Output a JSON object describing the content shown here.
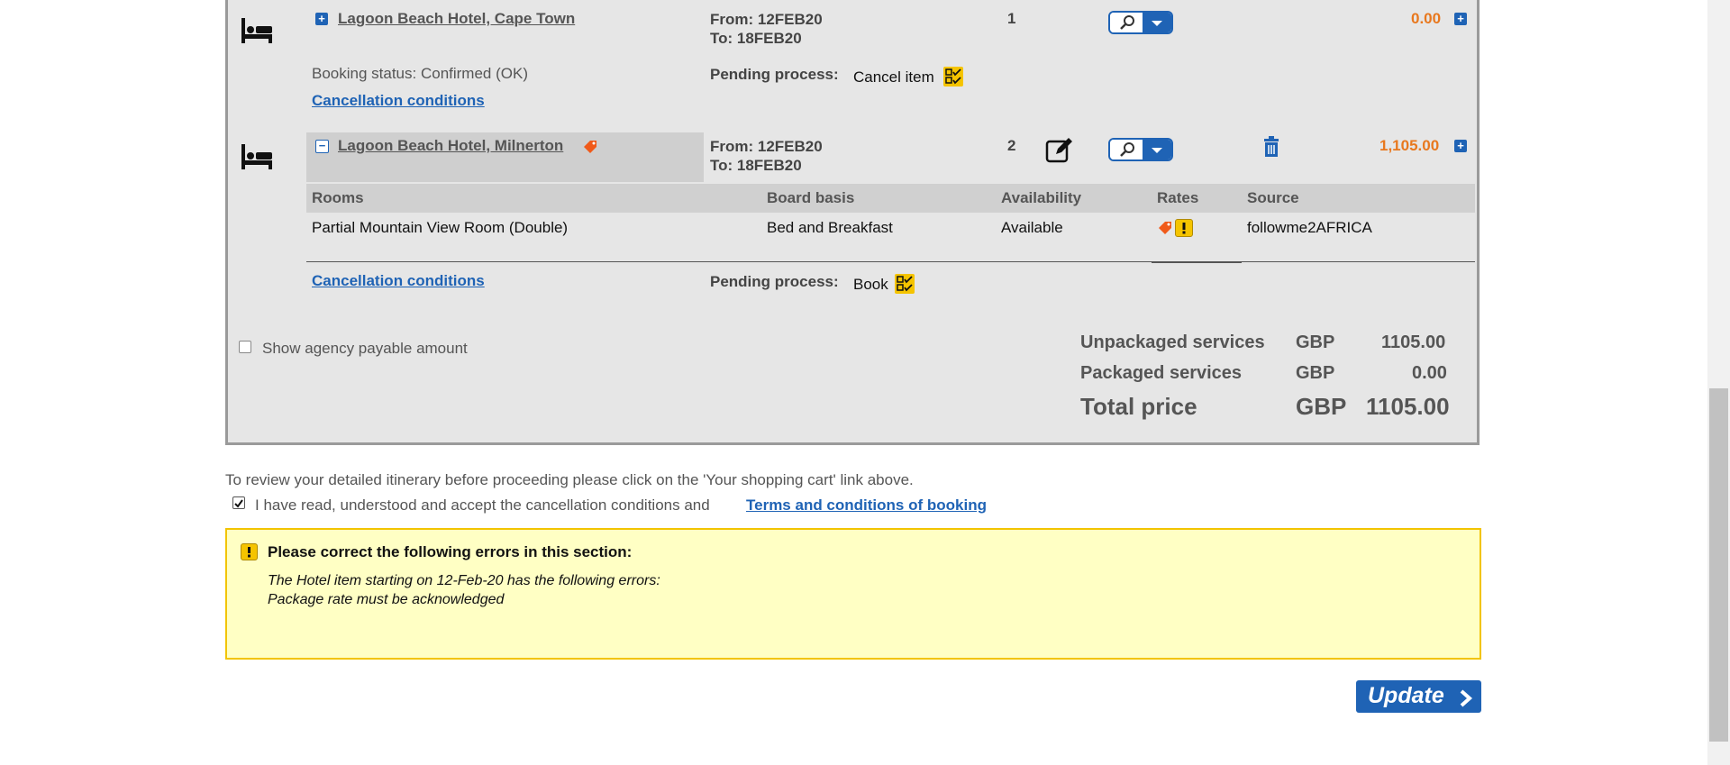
{
  "items": [
    {
      "hotel_name": "Lagoon Beach Hotel, Cape Town",
      "from": "From: 12FEB20",
      "to": "To: 18FEB20",
      "quantity": "1",
      "price": "0.00",
      "booking_status": "Booking status: Confirmed (OK)",
      "cancellation_link": "Cancellation conditions",
      "pending_label": "Pending process:",
      "pending_value": "Cancel item"
    },
    {
      "hotel_name": "Lagoon Beach Hotel, Milnerton",
      "from": "From: 12FEB20",
      "to": "To: 18FEB20",
      "quantity": "2",
      "price": "1,105.00",
      "table_headers": [
        "Rooms",
        "Board basis",
        "Availability",
        "Rates",
        "Source"
      ],
      "rooms": [
        {
          "room": "Partial Mountain View Room (Double)",
          "board": "Bed and Breakfast",
          "availability": "Available",
          "source": "followme2AFRICA"
        }
      ],
      "cancellation_link": "Cancellation conditions",
      "pending_label": "Pending process:",
      "pending_value": "Book"
    }
  ],
  "agency_checkbox_label": "Show agency payable amount",
  "summary": {
    "unpackaged_label": "Unpackaged services",
    "unpackaged_currency": "GBP",
    "unpackaged_amount": "1105.00",
    "packaged_label": "Packaged services",
    "packaged_currency": "GBP",
    "packaged_amount": "0.00",
    "total_label": "Total price",
    "total_currency": "GBP",
    "total_amount": "1105.00"
  },
  "review_text": "To review your detailed itinerary before proceeding please click on the 'Your shopping cart' link above.",
  "accept_text": "I have read, understood and accept the cancellation conditions and",
  "terms_link": "Terms and conditions of booking",
  "accept_checked": true,
  "error": {
    "title": "Please correct the following errors in this section:",
    "line1": "The Hotel item starting on 12-Feb-20 has the following errors:",
    "line2": "Package rate must be acknowledged"
  },
  "update_button": "Update",
  "colors": {
    "accent_blue": "#1f63b5",
    "price_orange": "#e8781e",
    "warning_yellow": "#f5c400",
    "error_bg": "#ffffc4"
  }
}
